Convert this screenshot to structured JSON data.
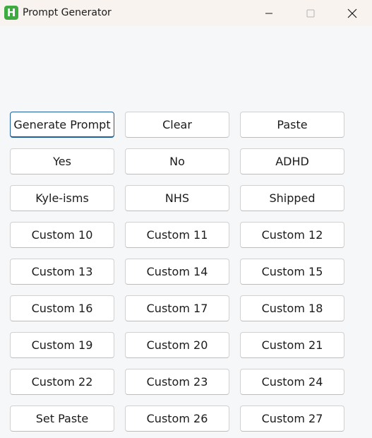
{
  "window": {
    "title": "Prompt Generator",
    "icon_letter": "H",
    "icon_color": "#3dab3f",
    "controls": [
      "minimize-icon",
      "maximize-icon",
      "close-icon"
    ]
  },
  "accent": "#1f5f9e",
  "buttons": [
    "Generate Prompt",
    "Clear",
    "Paste",
    "Yes",
    "No",
    "ADHD",
    "Kyle-isms",
    "NHS",
    "Shipped",
    "Custom 10",
    "Custom 11",
    "Custom 12",
    "Custom 13",
    "Custom 14",
    "Custom 15",
    "Custom 16",
    "Custom 17",
    "Custom 18",
    "Custom 19",
    "Custom 20",
    "Custom 21",
    "Custom 22",
    "Custom 23",
    "Custom 24",
    "Set Paste",
    "Custom 26",
    "Custom 27"
  ]
}
